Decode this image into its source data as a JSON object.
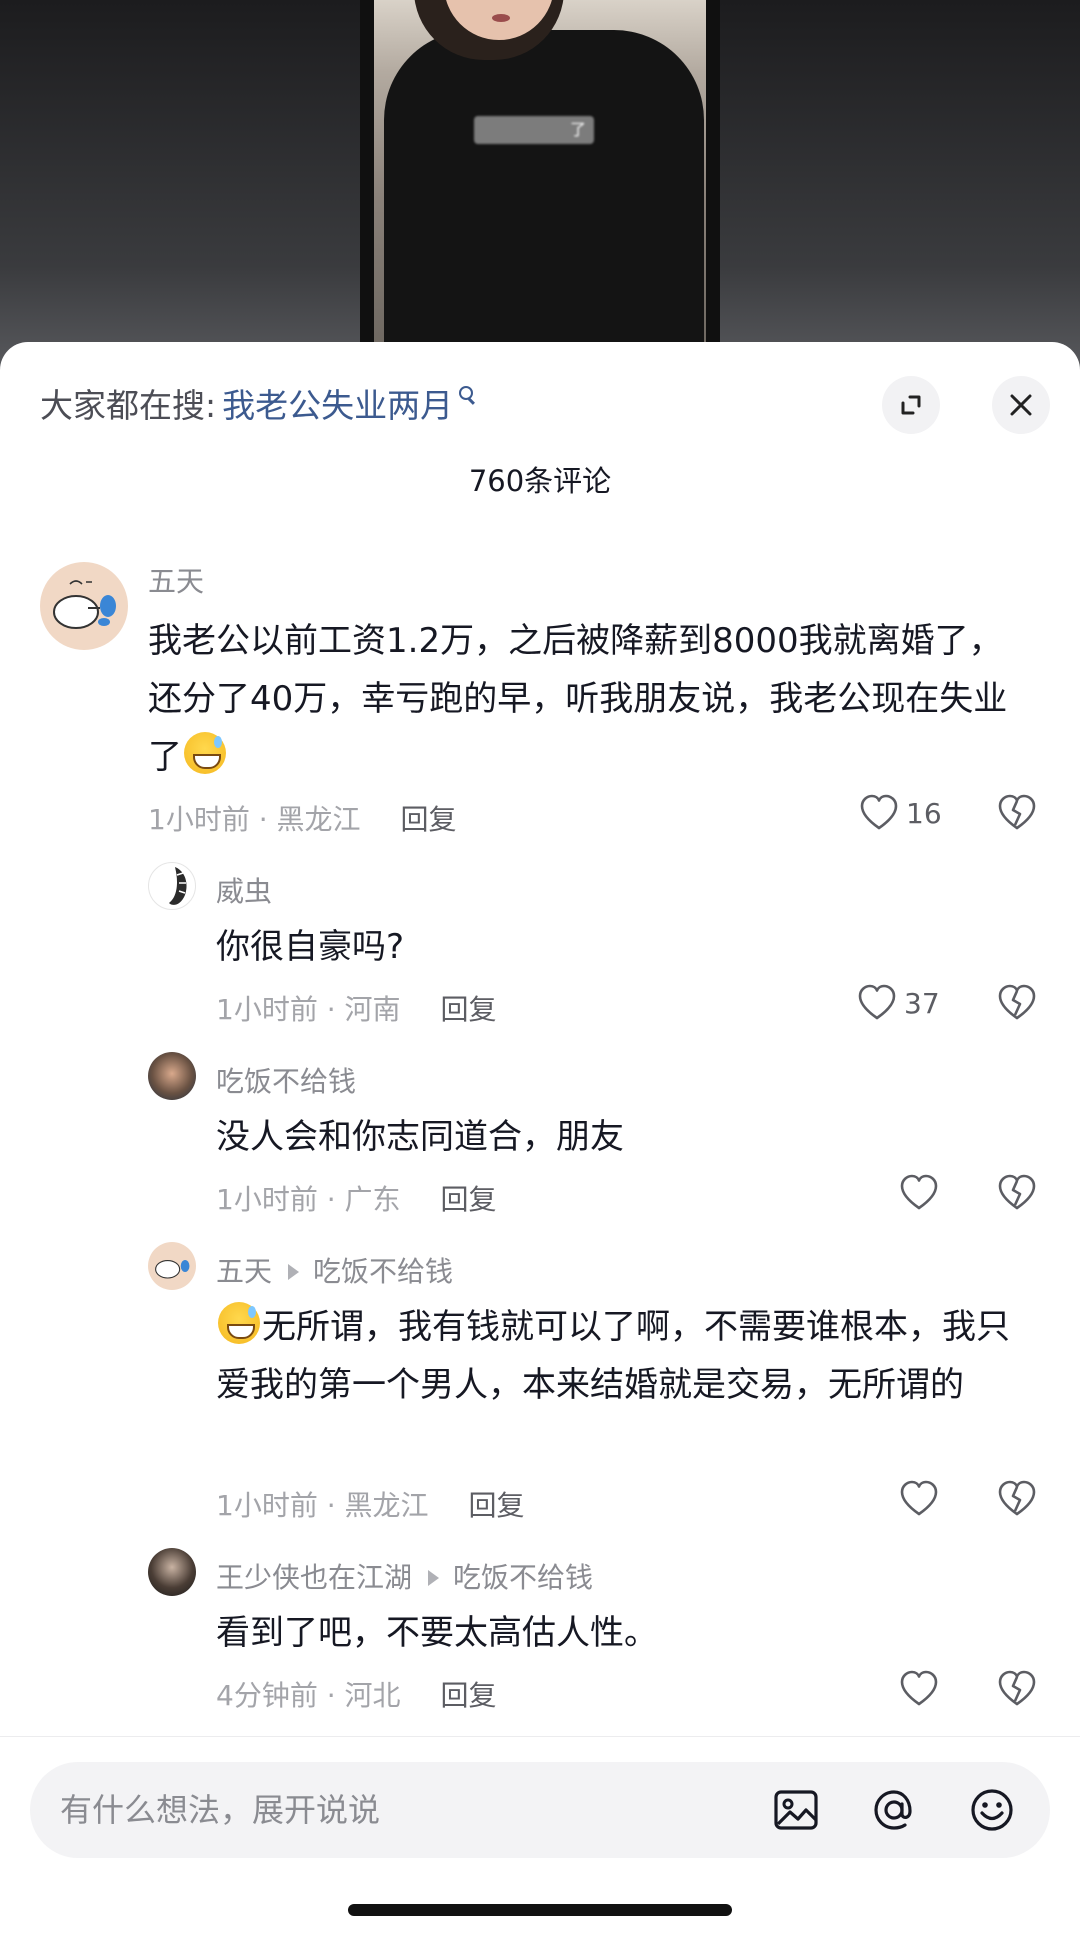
{
  "video": {
    "caption": "了"
  },
  "header": {
    "search_label": "大家都在搜:",
    "search_term": "我老公失业两月",
    "comment_count": "760条评论"
  },
  "comments": [
    {
      "user": "五天",
      "text_before_emoji": "我老公以前工资1.2万，之后被降薪到8000我就离婚了，还分了40万，幸亏跑的早，听我朋友说，我老公现在失业了",
      "time_location": "1小时前 · 黑龙江",
      "reply": "回复",
      "likes": "16"
    },
    {
      "user": "威虫",
      "text": "你很自豪吗?",
      "time_location": "1小时前 · 河南",
      "reply": "回复",
      "likes": "37"
    },
    {
      "user": "吃饭不给钱",
      "text": "没人会和你志同道合，朋友",
      "time_location": "1小时前 · 广东",
      "reply": "回复",
      "likes": ""
    },
    {
      "user": "五天",
      "reply_to": "吃饭不给钱",
      "text_after_emoji": "无所谓，我有钱就可以了啊，不需要谁根本，我只爱我的第一个男人，本来结婚就是交易，无所谓的",
      "time_location": "1小时前 · 黑龙江",
      "reply": "回复",
      "likes": ""
    },
    {
      "user": "王少侠也在江湖",
      "reply_to": "吃饭不给钱",
      "text": "看到了吧，不要太高估人性。",
      "time_location": "4分钟前 · 河北",
      "reply": "回复",
      "likes": ""
    }
  ],
  "input": {
    "placeholder": "有什么想法，展开说说"
  },
  "icons": {
    "expand": "expand-icon",
    "close": "close-icon",
    "like": "heart-icon",
    "dislike": "broken-heart-icon",
    "image": "image-icon",
    "mention": "at-mention-icon",
    "emoji": "emoji-icon"
  },
  "colors": {
    "search_term": "#3c5a8f",
    "muted": "#8a8b91",
    "text": "#161823"
  }
}
